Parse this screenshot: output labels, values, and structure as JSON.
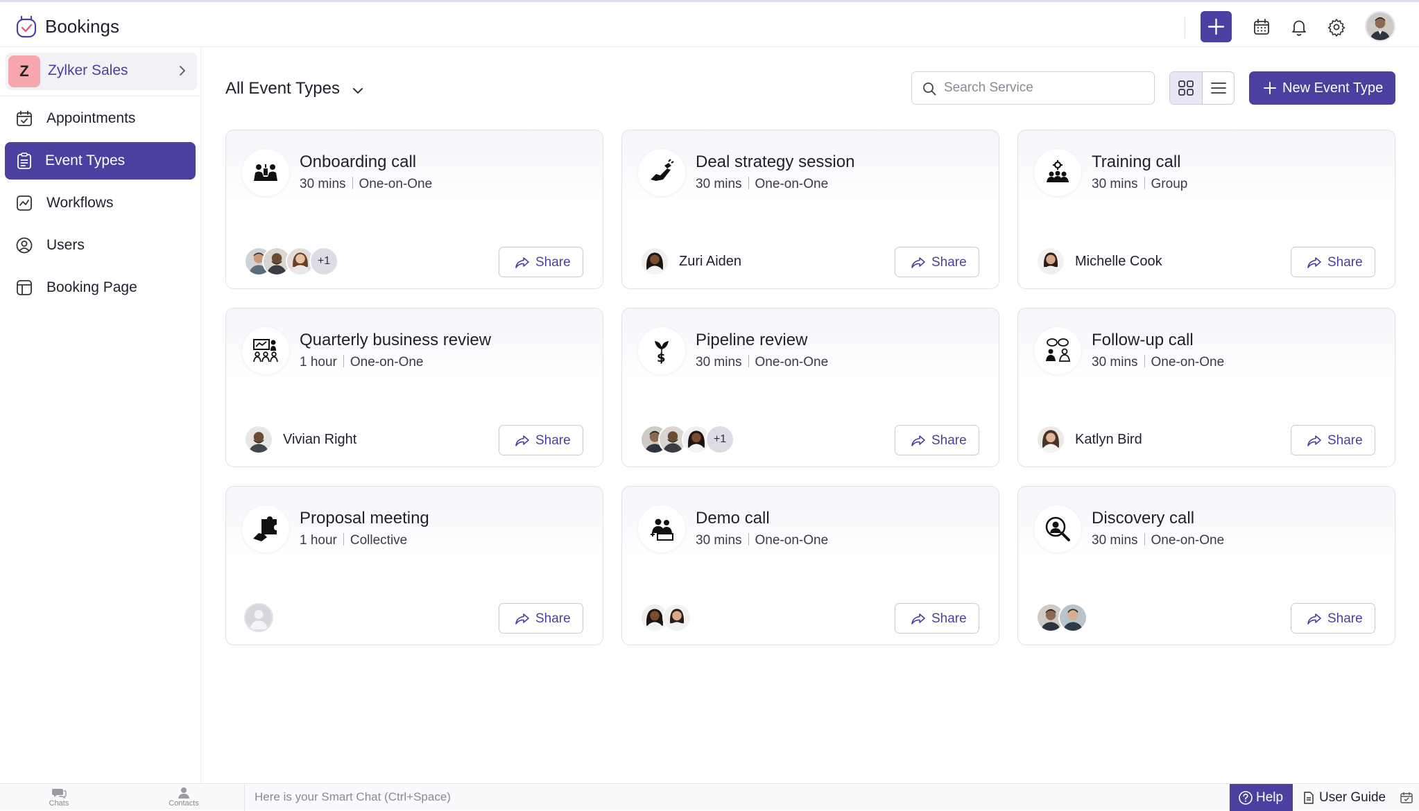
{
  "app": {
    "title": "Bookings"
  },
  "colors": {
    "accent": "#4b3fa0",
    "org_badge": "#f6a6ad"
  },
  "topbar": {
    "icons": [
      "plus-icon",
      "calendar-icon",
      "bell-icon",
      "gear-icon",
      "user-avatar"
    ]
  },
  "sidebar": {
    "org": {
      "initial": "Z",
      "name": "Zylker Sales"
    },
    "items": [
      {
        "label": "Appointments",
        "icon": "calendar-check-icon",
        "active": false
      },
      {
        "label": "Event Types",
        "icon": "clipboard-icon",
        "active": true
      },
      {
        "label": "Workflows",
        "icon": "workflow-icon",
        "active": false
      },
      {
        "label": "Users",
        "icon": "user-icon",
        "active": false
      },
      {
        "label": "Booking Page",
        "icon": "booking-page-icon",
        "active": false
      }
    ]
  },
  "main": {
    "title": "All Event Types",
    "search": {
      "placeholder": "Search Service",
      "value": ""
    },
    "view_mode": "grid",
    "new_button": "New Event Type",
    "share_label": "Share",
    "cards": [
      {
        "title": "Onboarding call",
        "duration": "30 mins",
        "type": "One-on-One",
        "icon": "team-meeting-icon",
        "host": "",
        "avatars": 3,
        "more": "+1"
      },
      {
        "title": "Deal strategy session",
        "duration": "30 mins",
        "type": "One-on-One",
        "icon": "handshake-icon",
        "host": "Zuri Aiden",
        "avatars": 1,
        "more": ""
      },
      {
        "title": "Training call",
        "duration": "30 mins",
        "type": "Group",
        "icon": "group-training-icon",
        "host": "Michelle Cook",
        "avatars": 1,
        "more": ""
      },
      {
        "title": "Quarterly business review",
        "duration": "1 hour",
        "type": "One-on-One",
        "icon": "presentation-icon",
        "host": "Vivian Right",
        "avatars": 1,
        "more": ""
      },
      {
        "title": "Pipeline review",
        "duration": "30 mins",
        "type": "One-on-One",
        "icon": "money-growth-icon",
        "host": "",
        "avatars": 3,
        "more": "+1"
      },
      {
        "title": "Follow-up call",
        "duration": "30 mins",
        "type": "One-on-One",
        "icon": "conversation-icon",
        "host": "Katlyn Bird",
        "avatars": 1,
        "more": ""
      },
      {
        "title": "Proposal meeting",
        "duration": "1 hour",
        "type": "Collective",
        "icon": "puzzle-hand-icon",
        "host": "",
        "avatars": 1,
        "more": ""
      },
      {
        "title": "Demo call",
        "duration": "30 mins",
        "type": "One-on-One",
        "icon": "demo-people-icon",
        "host": "",
        "avatars": 2,
        "more": ""
      },
      {
        "title": "Discovery call",
        "duration": "30 mins",
        "type": "One-on-One",
        "icon": "search-person-icon",
        "host": "",
        "avatars": 2,
        "more": ""
      }
    ]
  },
  "bottombar": {
    "chats": "Chats",
    "contacts": "Contacts",
    "smart_chat": "Here is your Smart Chat (Ctrl+Space)",
    "help": "Help",
    "user_guide": "User Guide"
  }
}
